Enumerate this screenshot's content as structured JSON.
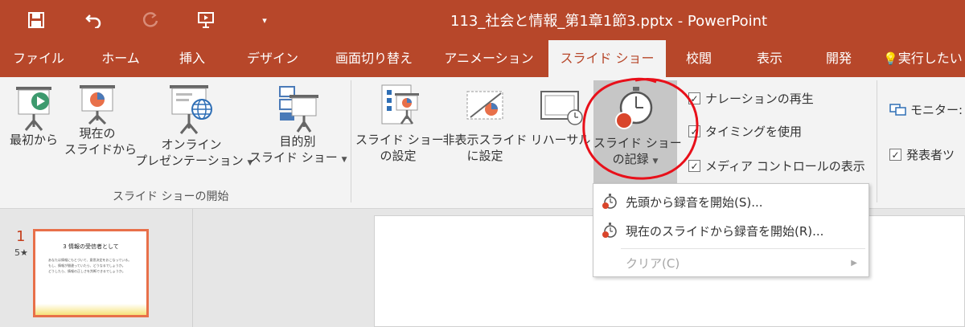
{
  "window": {
    "title": "113_社会と情報_第1章1節3.pptx - PowerPoint"
  },
  "qat": {
    "save_icon": "save-icon",
    "undo_icon": "undo-icon",
    "redo_icon": "redo-icon",
    "slideshow_icon": "start-slideshow-icon",
    "customize_icon": "customize-qat-icon"
  },
  "tabs": [
    {
      "label": "ファイル"
    },
    {
      "label": "ホーム"
    },
    {
      "label": "挿入"
    },
    {
      "label": "デザイン"
    },
    {
      "label": "画面切り替え"
    },
    {
      "label": "アニメーション"
    },
    {
      "label": "スライド ショー"
    },
    {
      "label": "校閲"
    },
    {
      "label": "表示"
    },
    {
      "label": "開発"
    },
    {
      "label": "実行したい"
    }
  ],
  "ribbon": {
    "start_group": {
      "label": "スライド ショーの開始",
      "from_beginning": "最初から",
      "from_current_1": "現在の",
      "from_current_2": "スライドから",
      "online_1": "オンライン",
      "online_2": "プレゼンテーション",
      "custom_1": "目的別",
      "custom_2": "スライド ショー"
    },
    "setup_group": {
      "setup_1": "スライド ショー",
      "setup_2": "の設定",
      "hide_1": "非表示スライド",
      "hide_2": "に設定",
      "rehearse": "リハーサル",
      "record_1": "スライド ショー",
      "record_2": "の記録"
    },
    "checks": {
      "narration": "ナレーションの再生",
      "timings": "タイミングを使用",
      "media": "メディア コントロールの表示"
    },
    "monitors": {
      "monitor_label": "モニター:",
      "presenter_label": "発表者ツ"
    }
  },
  "record_menu": {
    "item1": "先頭から録音を開始(S)...",
    "item2": "現在のスライドから録音を開始(R)...",
    "item3": "クリア(C)"
  },
  "slides": {
    "number": "1",
    "star": "5★",
    "thumb_title": "3 情報の受信者として",
    "thumb_lines": [
      "あなたは情報にもとづいて、意思決定をおこなっている。",
      "もし、情報が間違っていたら、どうなるでしょうか。",
      "どうしたら、情報の正しさを判断できるでしょうか。"
    ]
  },
  "colors": {
    "accent": "#b7472a",
    "annotation": "#e8101a"
  }
}
